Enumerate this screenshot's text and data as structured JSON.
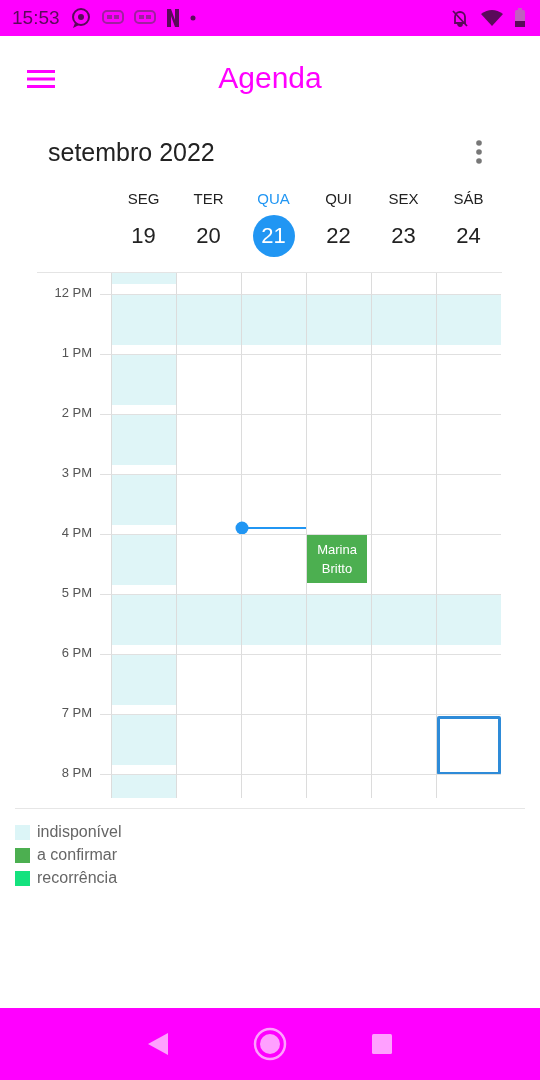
{
  "status_bar": {
    "time": "15:53"
  },
  "app_bar": {
    "title": "Agenda"
  },
  "month": "setembro 2022",
  "days": [
    {
      "weekday": "SEG",
      "date": "19",
      "selected": false
    },
    {
      "weekday": "TER",
      "date": "20",
      "selected": false
    },
    {
      "weekday": "QUA",
      "date": "21",
      "selected": true
    },
    {
      "weekday": "QUI",
      "date": "22",
      "selected": false
    },
    {
      "weekday": "SEX",
      "date": "23",
      "selected": false
    },
    {
      "weekday": "SÁB",
      "date": "24",
      "selected": false
    }
  ],
  "hours": [
    {
      "kind": "partial",
      "cells": [
        {
          "unavailable": true,
          "selected": false
        },
        {
          "unavailable": false,
          "selected": false
        },
        {
          "unavailable": false,
          "selected": false
        },
        {
          "unavailable": false,
          "selected": false
        },
        {
          "unavailable": false,
          "selected": false
        },
        {
          "unavailable": false,
          "selected": false
        }
      ]
    },
    {
      "kind": "hour",
      "label": "12 PM",
      "cells": [
        {
          "unavailable": true,
          "selected": false
        },
        {
          "unavailable": true,
          "selected": false
        },
        {
          "unavailable": true,
          "selected": false
        },
        {
          "unavailable": true,
          "selected": false
        },
        {
          "unavailable": true,
          "selected": false
        },
        {
          "unavailable": true,
          "selected": false
        }
      ]
    },
    {
      "kind": "hour",
      "label": "1 PM",
      "cells": [
        {
          "unavailable": true,
          "selected": false
        },
        {
          "unavailable": false,
          "selected": false
        },
        {
          "unavailable": false,
          "selected": false
        },
        {
          "unavailable": false,
          "selected": false
        },
        {
          "unavailable": false,
          "selected": false
        },
        {
          "unavailable": false,
          "selected": false
        }
      ]
    },
    {
      "kind": "hour",
      "label": "2 PM",
      "cells": [
        {
          "unavailable": true,
          "selected": false
        },
        {
          "unavailable": false,
          "selected": false
        },
        {
          "unavailable": false,
          "selected": false
        },
        {
          "unavailable": false,
          "selected": false
        },
        {
          "unavailable": false,
          "selected": false
        },
        {
          "unavailable": false,
          "selected": false
        }
      ]
    },
    {
      "kind": "hour",
      "label": "3 PM",
      "cells": [
        {
          "unavailable": true,
          "selected": false
        },
        {
          "unavailable": false,
          "selected": false
        },
        {
          "unavailable": false,
          "selected": false,
          "now": true
        },
        {
          "unavailable": false,
          "selected": false
        },
        {
          "unavailable": false,
          "selected": false
        },
        {
          "unavailable": false,
          "selected": false
        }
      ]
    },
    {
      "kind": "hour",
      "label": "4 PM",
      "cells": [
        {
          "unavailable": true,
          "selected": false
        },
        {
          "unavailable": false,
          "selected": false
        },
        {
          "unavailable": false,
          "selected": false
        },
        {
          "unavailable": false,
          "selected": false,
          "event": {
            "title": "Marina Britto",
            "color": "#4caf50"
          }
        },
        {
          "unavailable": false,
          "selected": false
        },
        {
          "unavailable": false,
          "selected": false
        }
      ]
    },
    {
      "kind": "hour",
      "label": "5 PM",
      "cells": [
        {
          "unavailable": true,
          "selected": false
        },
        {
          "unavailable": true,
          "selected": false
        },
        {
          "unavailable": true,
          "selected": false
        },
        {
          "unavailable": true,
          "selected": false
        },
        {
          "unavailable": true,
          "selected": false
        },
        {
          "unavailable": true,
          "selected": false
        }
      ]
    },
    {
      "kind": "hour",
      "label": "6 PM",
      "cells": [
        {
          "unavailable": true,
          "selected": false
        },
        {
          "unavailable": false,
          "selected": false
        },
        {
          "unavailable": false,
          "selected": false
        },
        {
          "unavailable": false,
          "selected": false
        },
        {
          "unavailable": false,
          "selected": false
        },
        {
          "unavailable": false,
          "selected": false
        }
      ]
    },
    {
      "kind": "hour",
      "label": "7 PM",
      "cells": [
        {
          "unavailable": true,
          "selected": false
        },
        {
          "unavailable": false,
          "selected": false
        },
        {
          "unavailable": false,
          "selected": false
        },
        {
          "unavailable": false,
          "selected": false
        },
        {
          "unavailable": false,
          "selected": false
        },
        {
          "unavailable": false,
          "selected": true
        }
      ]
    },
    {
      "kind": "tail",
      "label": "8 PM",
      "cells": [
        {
          "unavailable": true,
          "selected": false
        },
        {
          "unavailable": false,
          "selected": false
        },
        {
          "unavailable": false,
          "selected": false
        },
        {
          "unavailable": false,
          "selected": false
        },
        {
          "unavailable": false,
          "selected": false
        },
        {
          "unavailable": false,
          "selected": false
        }
      ]
    }
  ],
  "legend": [
    {
      "label": "indisponível",
      "color": "#dcf5f7"
    },
    {
      "label": "a confirmar",
      "color": "#4caf50"
    },
    {
      "label": "recorrência",
      "color": "#14e27e"
    }
  ]
}
